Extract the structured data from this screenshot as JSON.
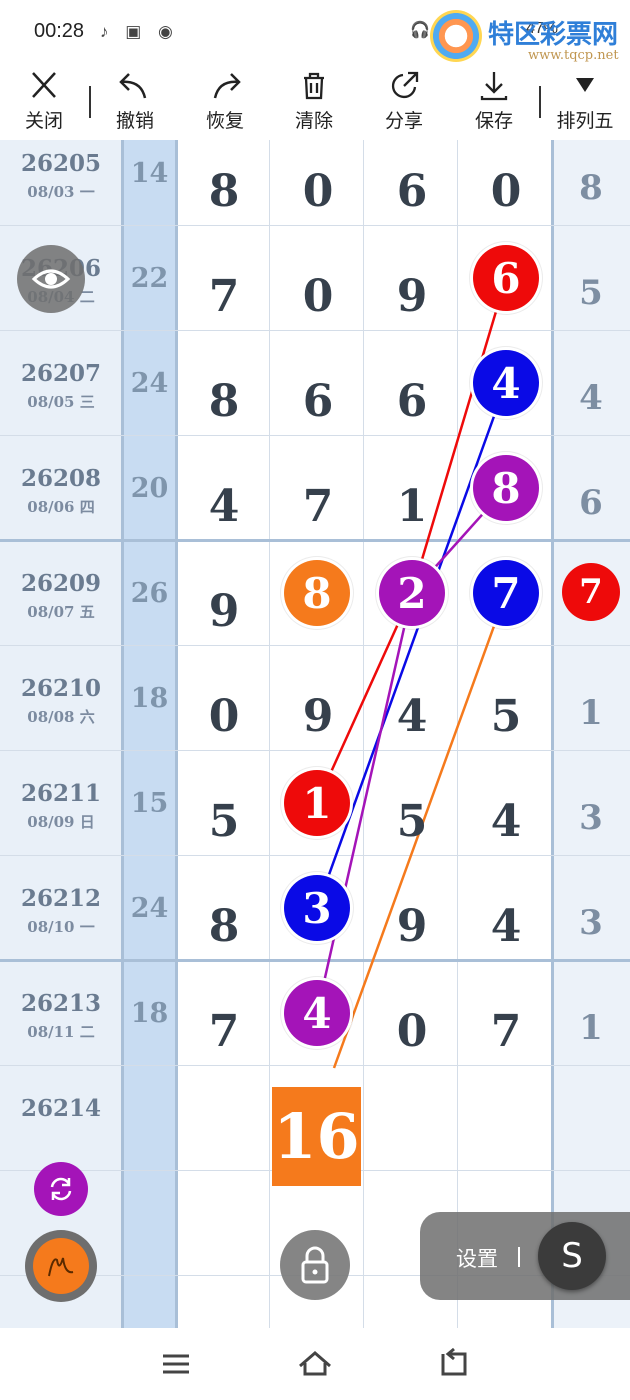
{
  "status_bar": {
    "time": "00:28",
    "right_text": "47%"
  },
  "watermark": {
    "name": "特区彩票网",
    "url": "www.tqcp.net"
  },
  "toolbar": {
    "close": "关闭",
    "undo": "撤销",
    "redo": "恢复",
    "clear": "清除",
    "share": "分享",
    "save": "保存",
    "mode": "排列五"
  },
  "rows": [
    {
      "period": "26205",
      "date": "08/03 一",
      "sum": "14",
      "d": [
        "8",
        "0",
        "6",
        "0"
      ],
      "last": "8"
    },
    {
      "period": "26206",
      "date": "08/04 二",
      "sum": "22",
      "d": [
        "7",
        "0",
        "9",
        "6"
      ],
      "last": "5"
    },
    {
      "period": "26207",
      "date": "08/05 三",
      "sum": "24",
      "d": [
        "8",
        "6",
        "6",
        "4"
      ],
      "last": "4"
    },
    {
      "period": "26208",
      "date": "08/06 四",
      "sum": "20",
      "d": [
        "4",
        "7",
        "1",
        "8"
      ],
      "last": "6"
    },
    {
      "period": "26209",
      "date": "08/07 五",
      "sum": "26",
      "d": [
        "9",
        "8",
        "2",
        "7"
      ],
      "last": "7"
    },
    {
      "period": "26210",
      "date": "08/08 六",
      "sum": "18",
      "d": [
        "0",
        "9",
        "4",
        "5"
      ],
      "last": "1"
    },
    {
      "period": "26211",
      "date": "08/09 日",
      "sum": "15",
      "d": [
        "5",
        "1",
        "5",
        "4"
      ],
      "last": "3"
    },
    {
      "period": "26212",
      "date": "08/10 一",
      "sum": "24",
      "d": [
        "8",
        "3",
        "9",
        "4"
      ],
      "last": "3"
    },
    {
      "period": "26213",
      "date": "08/11 二",
      "sum": "18",
      "d": [
        "7",
        "4",
        "0",
        "7"
      ],
      "last": "1"
    },
    {
      "period": "26214",
      "date": "",
      "sum": "",
      "d": [
        "",
        "",
        "",
        ""
      ],
      "last": ""
    }
  ],
  "sum_box": "16",
  "settings": {
    "label": "设置",
    "button": "S"
  },
  "colors": {
    "red": "#ee0a0a",
    "blue": "#0a0ae6",
    "purple": "#a414b8",
    "orange": "#f57a1c"
  },
  "icons": [
    "close-icon",
    "undo-icon",
    "redo-icon",
    "trash-icon",
    "share-icon",
    "download-icon",
    "triangle-down-icon",
    "eye-icon",
    "refresh-icon",
    "pen-icon",
    "lock-icon",
    "menu-icon",
    "home-icon",
    "back-icon"
  ]
}
